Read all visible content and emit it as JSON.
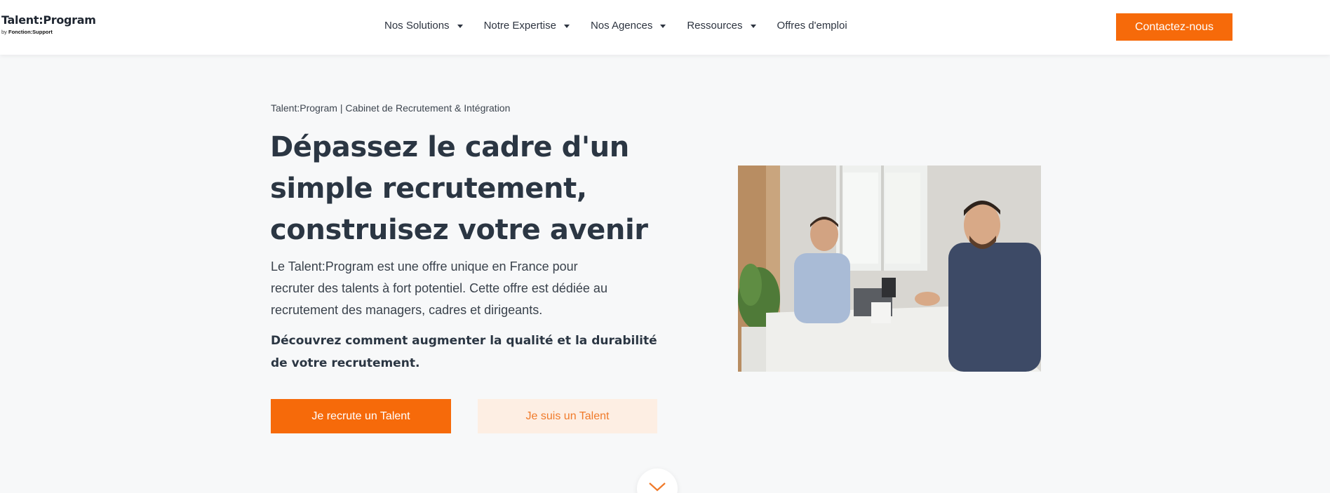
{
  "header": {
    "logo_main": "Talent:Program",
    "logo_by": "by",
    "logo_company": "Fonction:Support",
    "nav": [
      {
        "label": "Nos Solutions",
        "has_dropdown": true
      },
      {
        "label": "Notre Expertise",
        "has_dropdown": true
      },
      {
        "label": "Nos Agences",
        "has_dropdown": true
      },
      {
        "label": "Ressources",
        "has_dropdown": true
      },
      {
        "label": "Offres d'emploi",
        "has_dropdown": false
      }
    ],
    "contact_label": "Contactez-nous"
  },
  "hero": {
    "breadcrumb": "Talent:Program | Cabinet de Recrutement & Intégration",
    "title_lines": [
      "Dépassez le cadre d'un",
      "simple recrutement,",
      "construisez votre avenir"
    ],
    "description_lines": [
      "Le Talent:Program est une offre unique en France pour",
      "recruter des talents à fort potentiel. Cette offre est dédiée au",
      "recrutement des managers, cadres et dirigeants."
    ],
    "cta_text_lines": [
      "Découvrez comment augmenter la qualité et la durabilité",
      "de votre recrutement."
    ],
    "primary_button": "Je recrute un Talent",
    "secondary_button": "Je suis un Talent"
  },
  "icons": {
    "caret": "chevron-down-icon",
    "scroll": "chevron-down-icon"
  },
  "colors": {
    "accent": "#f66a0a",
    "accent_light": "#fdeee3",
    "text_dark": "#2b3643",
    "background": "#f7f8f9"
  }
}
